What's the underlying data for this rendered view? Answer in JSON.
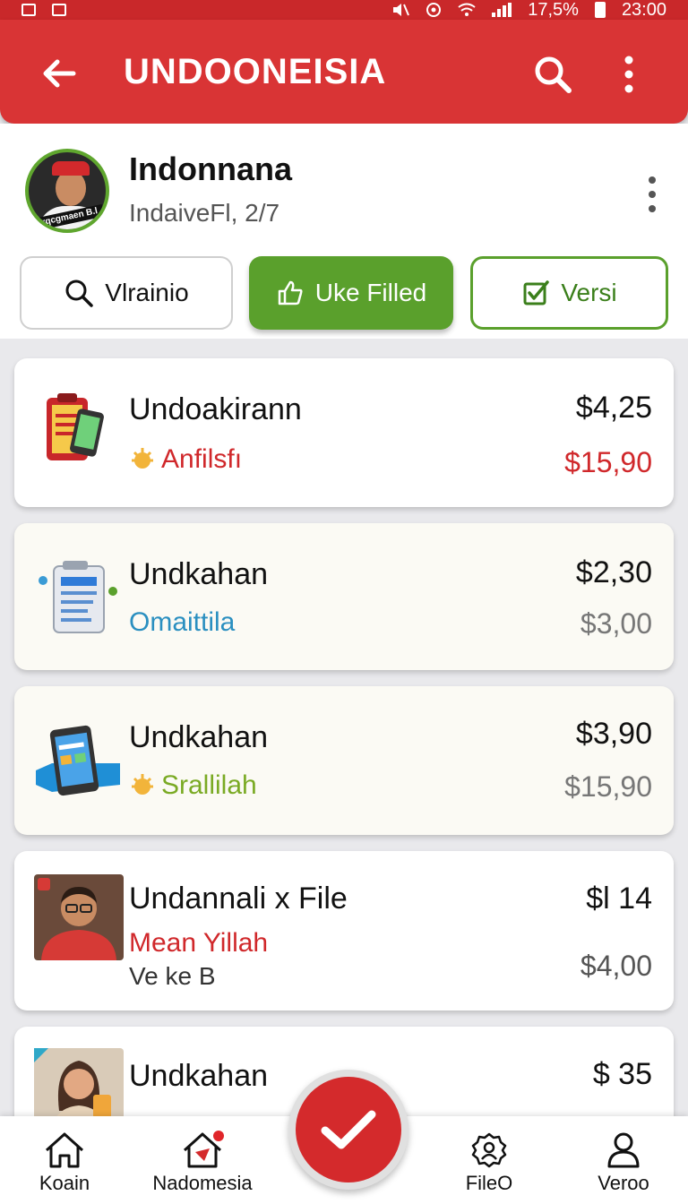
{
  "status_bar": {
    "left": "",
    "battery": "17,5%",
    "time": "23:00"
  },
  "app_bar": {
    "title": "UNDOONEISIA"
  },
  "profile": {
    "name": "Indonnana",
    "subtitle": "IndaiveFl, 2/7",
    "avatar_badge": "Iкqcgmaen B.l"
  },
  "filters": [
    {
      "label": "Vlrainio",
      "icon": "search-icon"
    },
    {
      "label": "Uke Filled",
      "icon": "thumbs-up-icon"
    },
    {
      "label": "Versi",
      "icon": "checkbox-icon"
    }
  ],
  "items": [
    {
      "title": "Undoakirann",
      "subtitle": "Anfilsfı",
      "subtitle_color": "#d0282b",
      "price": "$4,25",
      "old_price": "$15,90",
      "old_price_color": "#d0282b",
      "icon": "clipboard-phone-icon"
    },
    {
      "title": "Undkahan",
      "subtitle": "Omaittila",
      "subtitle_color": "#2a8fc0",
      "price": "$2,30",
      "old_price": "$3,00",
      "old_price_color": "#777777",
      "icon": "document-icon"
    },
    {
      "title": "Undkahan",
      "subtitle": "Srallilah",
      "subtitle_color": "#7aaa24",
      "price": "$3,90",
      "old_price": "$15,90",
      "old_price_color": "#777777",
      "icon": "phone-box-icon"
    },
    {
      "title": "Undannali x File",
      "subtitle": "Mean Yillah",
      "subtitle_color": "#d0282b",
      "extra": "Ve ke B",
      "price": "$l 14",
      "old_price": "$4,00",
      "old_price_color": "#555555",
      "icon": "person-photo-icon"
    },
    {
      "title": "Undkahan",
      "subtitle": "",
      "price": "$ 35",
      "icon": "woman-photo-icon"
    }
  ],
  "bottom_nav": [
    {
      "label": "Koain",
      "icon": "home-icon"
    },
    {
      "label": "Nadomesia",
      "icon": "house-badge-icon"
    },
    {
      "label": "FileO",
      "icon": "gear-person-icon"
    },
    {
      "label": "Veroo",
      "icon": "profile-icon"
    }
  ],
  "colors": {
    "primary": "#d93435",
    "accent_green": "#5aa02c"
  }
}
